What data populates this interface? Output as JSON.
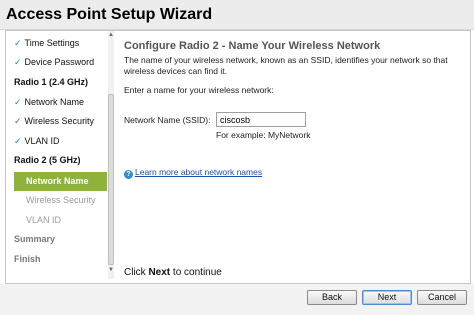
{
  "window": {
    "title": "Access Point Setup Wizard"
  },
  "sidebar": {
    "items": [
      {
        "label": "Time Settings",
        "state": "done"
      },
      {
        "label": "Device Password",
        "state": "done"
      },
      {
        "label": "Radio 1 (2.4 GHz)",
        "state": "section"
      },
      {
        "label": "Network Name",
        "state": "done"
      },
      {
        "label": "Wireless Security",
        "state": "done"
      },
      {
        "label": "VLAN ID",
        "state": "done"
      },
      {
        "label": "Radio 2 (5 GHz)",
        "state": "section"
      },
      {
        "label": "Network Name",
        "state": "active"
      },
      {
        "label": "Wireless Security",
        "state": "pending"
      },
      {
        "label": "VLAN ID",
        "state": "pending"
      },
      {
        "label": "Summary",
        "state": "pending-section"
      },
      {
        "label": "Finish",
        "state": "pending-section"
      }
    ],
    "check_glyph": "✓",
    "check_color": "#2a78c8",
    "active_color": "#8fb23b"
  },
  "main": {
    "heading": "Configure Radio 2 - Name Your Wireless Network",
    "description": "The name of your wireless network, known as an SSID, identifies your network so that wireless devices can find it.",
    "prompt": "Enter a name for your wireless network:",
    "ssid_label": "Network Name (SSID):",
    "ssid_value": "ciscosb",
    "example": "For example: MyNetwork",
    "learn_more": "Learn more about network names",
    "help_icon": "?",
    "continue_prefix": "Click",
    "continue_bold": "Next",
    "continue_suffix": "to continue"
  },
  "footer": {
    "back_label": "Back",
    "next_label": "Next",
    "cancel_label": "Cancel"
  }
}
